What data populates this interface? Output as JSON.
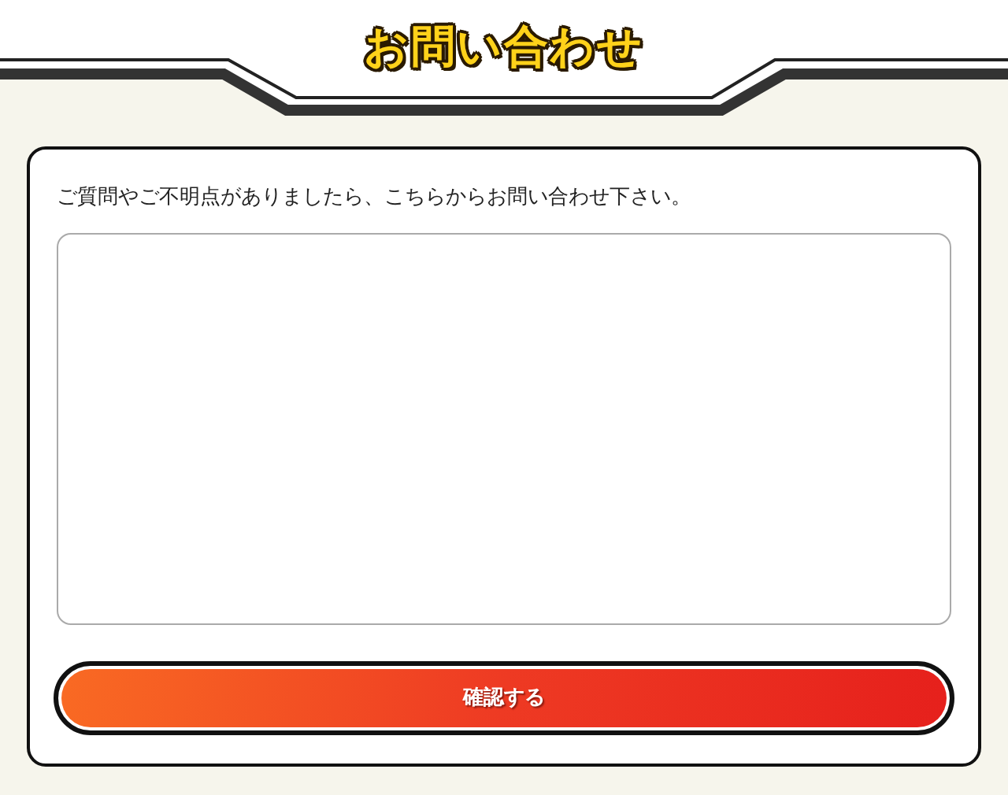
{
  "header": {
    "title": "お問い合わせ"
  },
  "form": {
    "intro": "ご質問やご不明点がありましたら、こちらからお問い合わせ下さい。",
    "submit": {
      "label": "確認する"
    }
  }
}
